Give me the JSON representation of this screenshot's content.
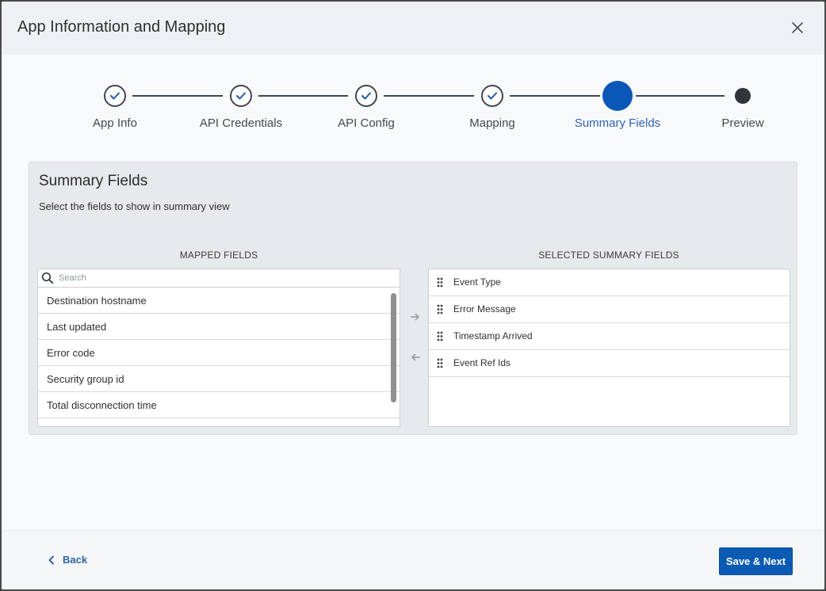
{
  "modal": {
    "title": "App Information and Mapping"
  },
  "stepper": {
    "steps": [
      {
        "label": "App Info",
        "state": "done"
      },
      {
        "label": "API Credentials",
        "state": "done"
      },
      {
        "label": "API Config",
        "state": "done"
      },
      {
        "label": "Mapping",
        "state": "done"
      },
      {
        "label": "Summary Fields",
        "state": "active"
      },
      {
        "label": "Preview",
        "state": "pending"
      }
    ]
  },
  "panel": {
    "title": "Summary Fields",
    "subtitle": "Select the fields to show in summary view",
    "mapped": {
      "header": "MAPPED FIELDS",
      "search_placeholder": "Search",
      "items": [
        "Destination hostname",
        "Last updated",
        "Error code",
        "Security group id",
        "Total disconnection time"
      ]
    },
    "selected": {
      "header": "SELECTED SUMMARY FIELDS",
      "items": [
        "Event Type",
        "Error Message",
        "Timestamp Arrived",
        "Event Ref Ids"
      ]
    }
  },
  "footer": {
    "back_label": "Back",
    "save_label": "Save & Next"
  },
  "colors": {
    "accent": "#0b57b7",
    "active_label": "#2f64b2",
    "stepper_line": "#3f4852"
  },
  "icons": {
    "close": "close-icon",
    "done_step": "check-icon",
    "search": "search-icon",
    "drag": "drag-handle-icon",
    "add": "arrow-right-icon",
    "remove": "arrow-left-icon",
    "back": "chevron-left-icon"
  }
}
